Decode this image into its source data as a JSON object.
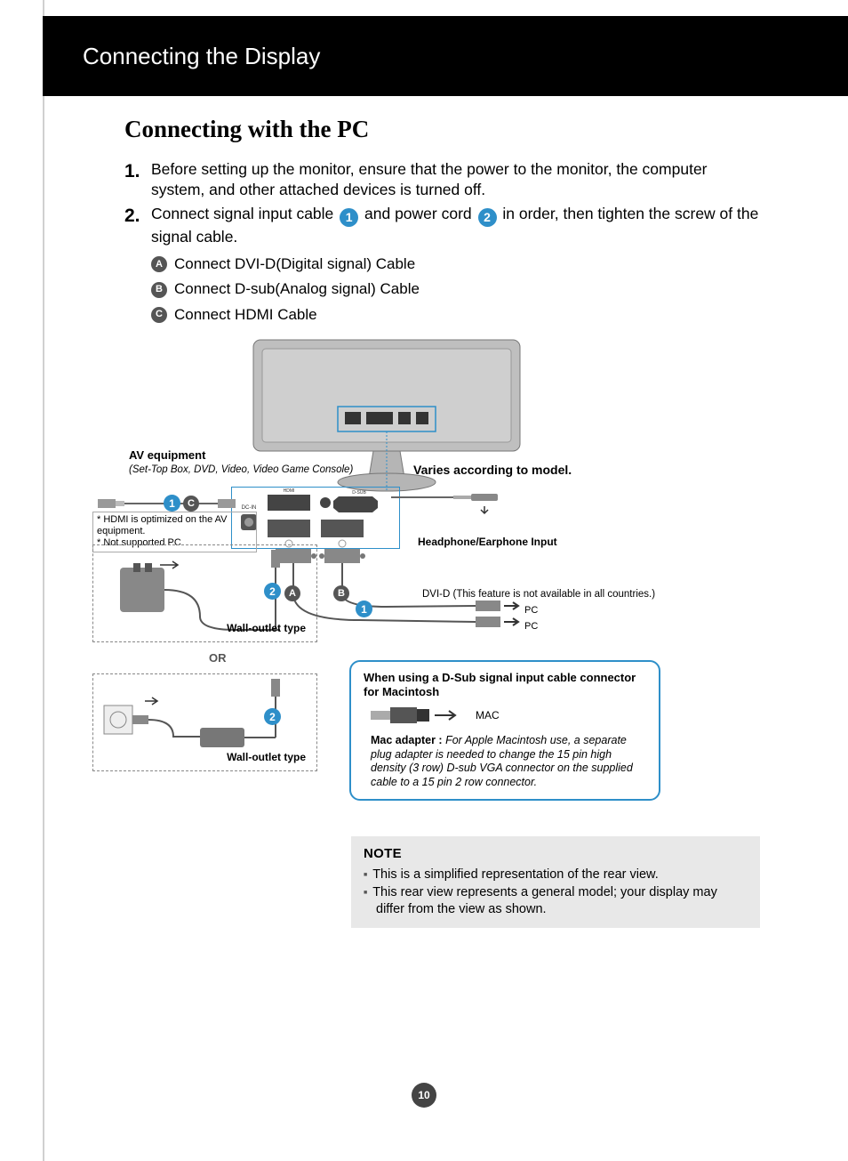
{
  "header": {
    "title": "Connecting the Display"
  },
  "section_heading": "Connecting with the PC",
  "steps": {
    "s1": {
      "num": "1.",
      "text": "Before setting up the monitor, ensure that the power to the monitor, the computer system, and other attached devices is turned off."
    },
    "s2": {
      "num": "2.",
      "pre": "Connect signal input cable ",
      "mid": " and power cord ",
      "post": " in order, then tighten the screw of the signal cable."
    }
  },
  "sub_items": {
    "a": "Connect DVI-D(Digital signal) Cable",
    "b": "Connect D-sub(Analog signal) Cable",
    "c": "Connect HDMI Cable"
  },
  "labels": {
    "av_equipment": "AV equipment",
    "av_equipment_sub": "(Set-Top Box, DVD, Video, Video Game Console)",
    "varies": "Varies according to model.",
    "headphone": "Headphone/Earphone Input",
    "hdmi_note_l1": "* HDMI is optimized on the AV equipment.",
    "hdmi_note_l2": "* Not supported PC",
    "wall_outlet": "Wall-outlet type",
    "or": "OR",
    "dvi_d": "DVI-D (This feature is not available in all countries.)",
    "pc": "PC",
    "mac": "MAC"
  },
  "mac_box": {
    "title": "When using a D-Sub signal input cable connector for Macintosh",
    "lead": "Mac adapter : ",
    "body": "For Apple Macintosh use, a separate plug adapter is needed to change the 15 pin high density (3 row) D-sub VGA connector on the supplied cable to a 15 pin 2 row connector."
  },
  "note": {
    "heading": "NOTE",
    "items": [
      "This is a simplified representation of the rear view.",
      "This rear view represents a general model; your display may differ from the view as shown."
    ]
  },
  "badges": {
    "one": "1",
    "two": "2",
    "A": "A",
    "B": "B",
    "C": "C"
  },
  "page_number": "10"
}
